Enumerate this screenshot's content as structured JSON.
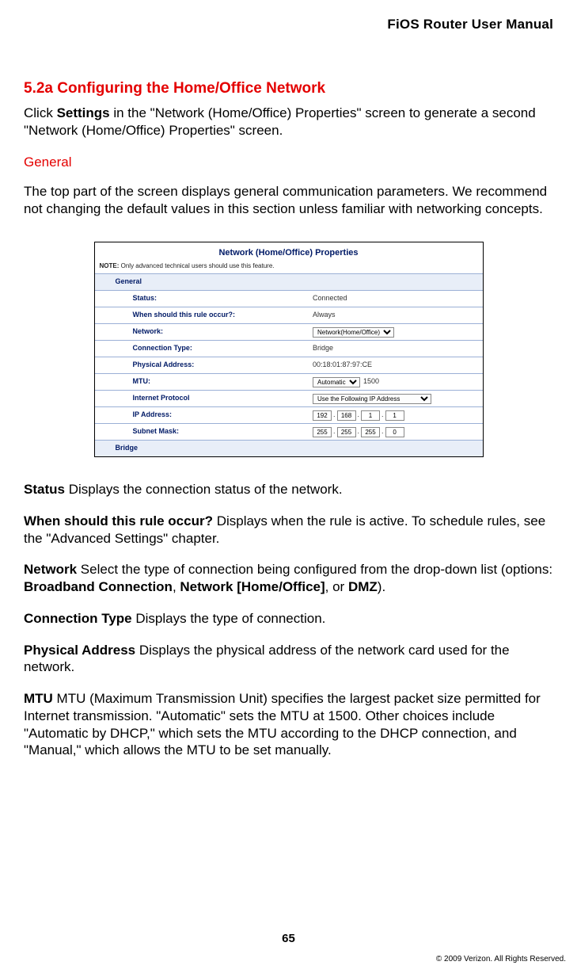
{
  "header": {
    "title": "FiOS Router User Manual"
  },
  "section": {
    "number_title": "5.2a  Configuring the Home/Office Network",
    "intro_prefix": "Click ",
    "intro_bold": "Settings",
    "intro_suffix": " in the \"Network (Home/Office) Properties\" screen to generate a second \"Network (Home/Office) Properties\" screen."
  },
  "general": {
    "heading": "General",
    "para": "The top part of the screen displays general communication parameters. We recommend not changing the default values in this section unless familiar with networking concepts."
  },
  "panel": {
    "title": "Network (Home/Office) Properties",
    "note_bold": "NOTE:",
    "note_rest": " Only advanced technical users should use this feature.",
    "group_general": "General",
    "rows": {
      "status_label": "Status:",
      "status_value": "Connected",
      "rule_label": "When should this rule occur?:",
      "rule_value": "Always",
      "network_label": "Network:",
      "network_value": "Network(Home/Office)",
      "conntype_label": "Connection Type:",
      "conntype_value": "Bridge",
      "phys_label": "Physical Address:",
      "phys_value": "00:18:01:87:97:CE",
      "mtu_label": "MTU:",
      "mtu_select": "Automatic",
      "mtu_num": "1500",
      "inet_label": "Internet Protocol",
      "inet_value": "Use the Following IP Address",
      "ip_label": "IP Address:",
      "ip_octets": [
        "192",
        "168",
        "1",
        "1"
      ],
      "mask_label": "Subnet Mask:",
      "mask_octets": [
        "255",
        "255",
        "255",
        "0"
      ],
      "bridge_label": "Bridge"
    }
  },
  "defs": {
    "status_b": "Status",
    "status_t": "  Displays the connection status of the network.",
    "rule_b": "When should this rule occur?",
    "rule_t": "  Displays when the rule is active. To schedule rules, see the \"Advanced Settings\" chapter.",
    "net_b": "Network",
    "net_t1": "  Select the type of connection being configured from the drop-down list (options: ",
    "net_opt1": "Broadband Connection",
    "net_sep1": ", ",
    "net_opt2": "Network [Home/Office]",
    "net_sep2": ", or ",
    "net_opt3": "DMZ",
    "net_t2": ").",
    "ctype_b": "Connection Type",
    "ctype_t": "  Displays the type of connection.",
    "phys_b": "Physical Address",
    "phys_t": "  Displays the physical address of the network card used for the network.",
    "mtu_b": "MTU",
    "mtu_t": "  MTU (Maximum Transmission Unit) specifies the largest packet size permitted for Internet transmission. \"Automatic\" sets the MTU at 1500. Other choices include \"Automatic by DHCP,\" which sets the MTU according to the DHCP connection, and \"Manual,\" which allows the MTU to be set manually."
  },
  "footer": {
    "page": "65",
    "copy": "© 2009 Verizon. All Rights Reserved."
  }
}
